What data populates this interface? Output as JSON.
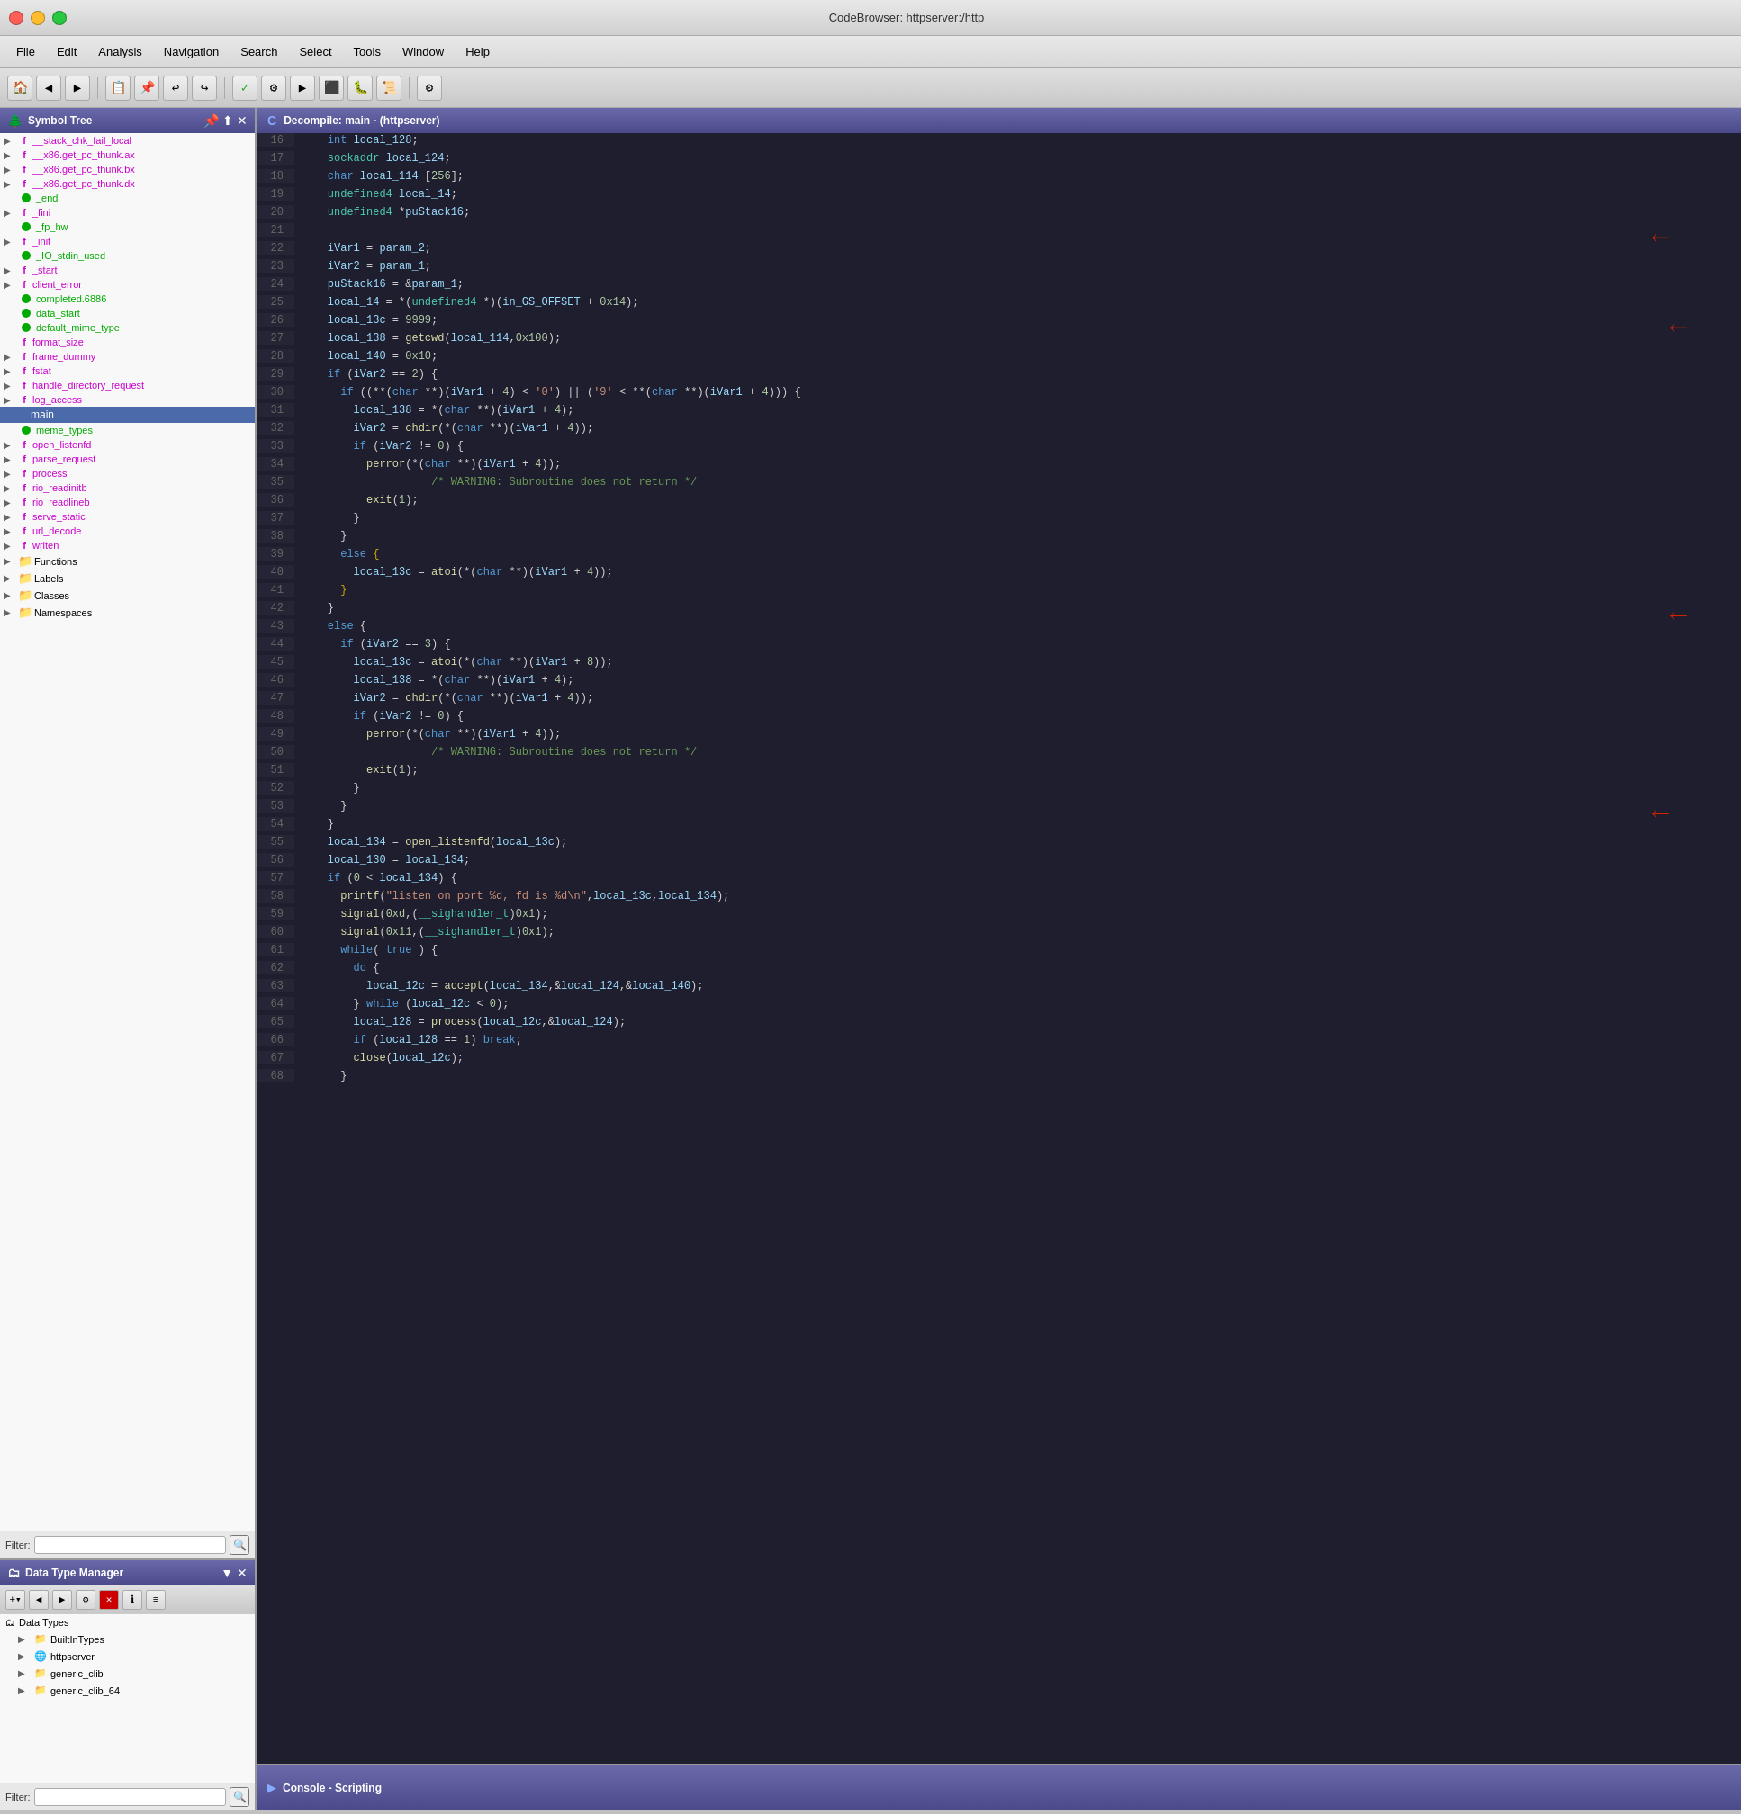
{
  "titlebar": {
    "title": "CodeBrowser: httpserver:/http",
    "controls": [
      "close",
      "minimize",
      "maximize"
    ]
  },
  "menubar": {
    "items": [
      "File",
      "Edit",
      "Analysis",
      "Navigation",
      "Search",
      "Select",
      "Tools",
      "Window",
      "Help"
    ]
  },
  "symbol_tree": {
    "title": "Symbol Tree",
    "items": [
      {
        "type": "func",
        "label": "__stack_chk_fail_local",
        "indent": 1,
        "has_arrow": true
      },
      {
        "type": "func",
        "label": "__x86.get_pc_thunk.ax",
        "indent": 1,
        "has_arrow": true
      },
      {
        "type": "func",
        "label": "__x86.get_pc_thunk.bx",
        "indent": 1,
        "has_arrow": true
      },
      {
        "type": "func",
        "label": "__x86.get_pc_thunk.dx",
        "indent": 1,
        "has_arrow": true
      },
      {
        "type": "dot",
        "label": "_end",
        "indent": 1
      },
      {
        "type": "func",
        "label": "_fini",
        "indent": 1,
        "has_arrow": true
      },
      {
        "type": "dot",
        "label": "_fp_hw",
        "indent": 1
      },
      {
        "type": "func",
        "label": "_init",
        "indent": 1,
        "has_arrow": true
      },
      {
        "type": "dot",
        "label": "_IO_stdin_used",
        "indent": 1
      },
      {
        "type": "func",
        "label": "_start",
        "indent": 1,
        "has_arrow": true
      },
      {
        "type": "func",
        "label": "client_error",
        "indent": 1,
        "has_arrow": true
      },
      {
        "type": "dot",
        "label": "completed.6886",
        "indent": 1
      },
      {
        "type": "dot",
        "label": "data_start",
        "indent": 1
      },
      {
        "type": "dot",
        "label": "default_mime_type",
        "indent": 1
      },
      {
        "type": "func_dot",
        "label": "format_size",
        "indent": 1,
        "has_arrow": true
      },
      {
        "type": "func_dot2",
        "label": "frame_dummy",
        "indent": 1,
        "has_arrow": true
      },
      {
        "type": "func",
        "label": "fstat",
        "indent": 1,
        "has_arrow": true
      },
      {
        "type": "func",
        "label": "handle_directory_request",
        "indent": 1,
        "has_arrow": true
      },
      {
        "type": "func",
        "label": "log_access",
        "indent": 1,
        "has_arrow": true
      },
      {
        "type": "selected",
        "label": "main",
        "indent": 1
      },
      {
        "type": "dot",
        "label": "meme_types",
        "indent": 1
      },
      {
        "type": "func",
        "label": "open_listenfd",
        "indent": 1,
        "has_arrow": true
      },
      {
        "type": "func",
        "label": "parse_request",
        "indent": 1,
        "has_arrow": true
      },
      {
        "type": "func",
        "label": "process",
        "indent": 1,
        "has_arrow": true
      },
      {
        "type": "func",
        "label": "rio_readinitb",
        "indent": 1,
        "has_arrow": true
      },
      {
        "type": "func",
        "label": "rio_readlineb",
        "indent": 1,
        "has_arrow": true
      },
      {
        "type": "func",
        "label": "serve_static",
        "indent": 1,
        "has_arrow": true
      },
      {
        "type": "func",
        "label": "url_decode",
        "indent": 1,
        "has_arrow": true
      },
      {
        "type": "func",
        "label": "writen",
        "indent": 1,
        "has_arrow": true
      }
    ],
    "groups": [
      {
        "label": "Functions",
        "icon": "folder"
      },
      {
        "label": "Labels",
        "icon": "folder"
      },
      {
        "label": "Classes",
        "icon": "folder"
      },
      {
        "label": "Namespaces",
        "icon": "folder"
      }
    ],
    "filter_label": "Filter:"
  },
  "data_type_manager": {
    "title": "Data Type Manager",
    "items": [
      {
        "label": "Data Types",
        "icon": "root",
        "indent": 0
      },
      {
        "label": "BuiltInTypes",
        "icon": "folder",
        "indent": 1
      },
      {
        "label": "httpserver",
        "icon": "folder-globe",
        "indent": 1
      },
      {
        "label": "generic_clib",
        "icon": "folder-green",
        "indent": 1
      },
      {
        "label": "generic_clib_64",
        "icon": "folder-green",
        "indent": 1
      }
    ],
    "filter_label": "Filter:"
  },
  "code_view": {
    "title": "Decompile: main  -  (httpserver)",
    "lines": [
      {
        "num": 16,
        "content": "    int local_128;"
      },
      {
        "num": 17,
        "content": "    sockaddr local_124;"
      },
      {
        "num": 18,
        "content": "    char local_114 [256];"
      },
      {
        "num": 19,
        "content": "    undefined4 local_14;"
      },
      {
        "num": 20,
        "content": "    undefined4 *puStack16;"
      },
      {
        "num": 21,
        "content": "",
        "arrow": true
      },
      {
        "num": 22,
        "content": "    iVar1 = param_2;"
      },
      {
        "num": 23,
        "content": "    iVar2 = param_1;"
      },
      {
        "num": 24,
        "content": "    puStack16 = &param_1;"
      },
      {
        "num": 25,
        "content": "    local_14 = *(undefined4 *)(in_GS_OFFSET + 0x14);"
      },
      {
        "num": 26,
        "content": "    local_13c = 9999;",
        "arrow": true
      },
      {
        "num": 27,
        "content": "    local_138 = getcwd(local_114,0x100);"
      },
      {
        "num": 28,
        "content": "    local_140 = 0x10;"
      },
      {
        "num": 29,
        "content": "    if (iVar2 == 2) {"
      },
      {
        "num": 30,
        "content": "      if ((**( char **)(iVar1 + 4) < '0') || ('9' < **(char **)(iVar1 + 4))) {"
      },
      {
        "num": 31,
        "content": "        local_138 = *(char **)(iVar1 + 4);"
      },
      {
        "num": 32,
        "content": "        iVar2 = chdir(*(char **)(iVar1 + 4));"
      },
      {
        "num": 33,
        "content": "        if (iVar2 != 0) {"
      },
      {
        "num": 34,
        "content": "          perror(*(char **)(iVar1 + 4));"
      },
      {
        "num": 35,
        "content": "                    /* WARNING: Subroutine does not return */"
      },
      {
        "num": 36,
        "content": "          exit(1);"
      },
      {
        "num": 37,
        "content": "        }"
      },
      {
        "num": 38,
        "content": "      }"
      },
      {
        "num": 39,
        "content": "      else {"
      },
      {
        "num": 40,
        "content": "        local_13c = atoi(*(char **)(iVar1 + 4));"
      },
      {
        "num": 41,
        "content": "      }"
      },
      {
        "num": 42,
        "content": "    }",
        "arrow": true
      },
      {
        "num": 43,
        "content": "    else {"
      },
      {
        "num": 44,
        "content": "      if (iVar2 == 3) {"
      },
      {
        "num": 45,
        "content": "        local_13c = atoi(*(char **)(iVar1 + 8));"
      },
      {
        "num": 46,
        "content": "        local_138 = *(char **)(iVar1 + 4);"
      },
      {
        "num": 47,
        "content": "        iVar2 = chdir(*(char **)(iVar1 + 4));"
      },
      {
        "num": 48,
        "content": "        if (iVar2 != 0) {"
      },
      {
        "num": 49,
        "content": "          perror(*(char **)(iVar1 + 4));"
      },
      {
        "num": 50,
        "content": "                    /* WARNING: Subroutine does not return */"
      },
      {
        "num": 51,
        "content": "          exit(1);"
      },
      {
        "num": 52,
        "content": "        }"
      },
      {
        "num": 53,
        "content": "      }",
        "arrow": true
      },
      {
        "num": 54,
        "content": "    }"
      },
      {
        "num": 55,
        "content": "    local_134 = open_listenfd(local_13c);"
      },
      {
        "num": 56,
        "content": "    local_130 = local_134;"
      },
      {
        "num": 57,
        "content": "    if (0 < local_134) {"
      },
      {
        "num": 58,
        "content": "      printf(\"listen on port %d, fd is %d\\n\",local_13c,local_134);"
      },
      {
        "num": 59,
        "content": "      signal(0xd,(__sighandler_t)0x1);"
      },
      {
        "num": 60,
        "content": "      signal(0x11,(__sighandler_t)0x1);"
      },
      {
        "num": 61,
        "content": "      while( true ) {"
      },
      {
        "num": 62,
        "content": "        do {"
      },
      {
        "num": 63,
        "content": "          local_12c = accept(local_134,&local_124,&local_140);"
      },
      {
        "num": 64,
        "content": "        } while (local_12c < 0);"
      },
      {
        "num": 65,
        "content": "        local_128 = process(local_12c,&local_124);"
      },
      {
        "num": 66,
        "content": "        if (local_128 == 1) break;"
      },
      {
        "num": 67,
        "content": "        close(local_12c);"
      },
      {
        "num": 68,
        "content": "      }"
      }
    ]
  },
  "console": {
    "title": "Console - Scripting"
  },
  "arrows": {
    "positions": [
      21,
      26,
      42,
      53
    ]
  }
}
